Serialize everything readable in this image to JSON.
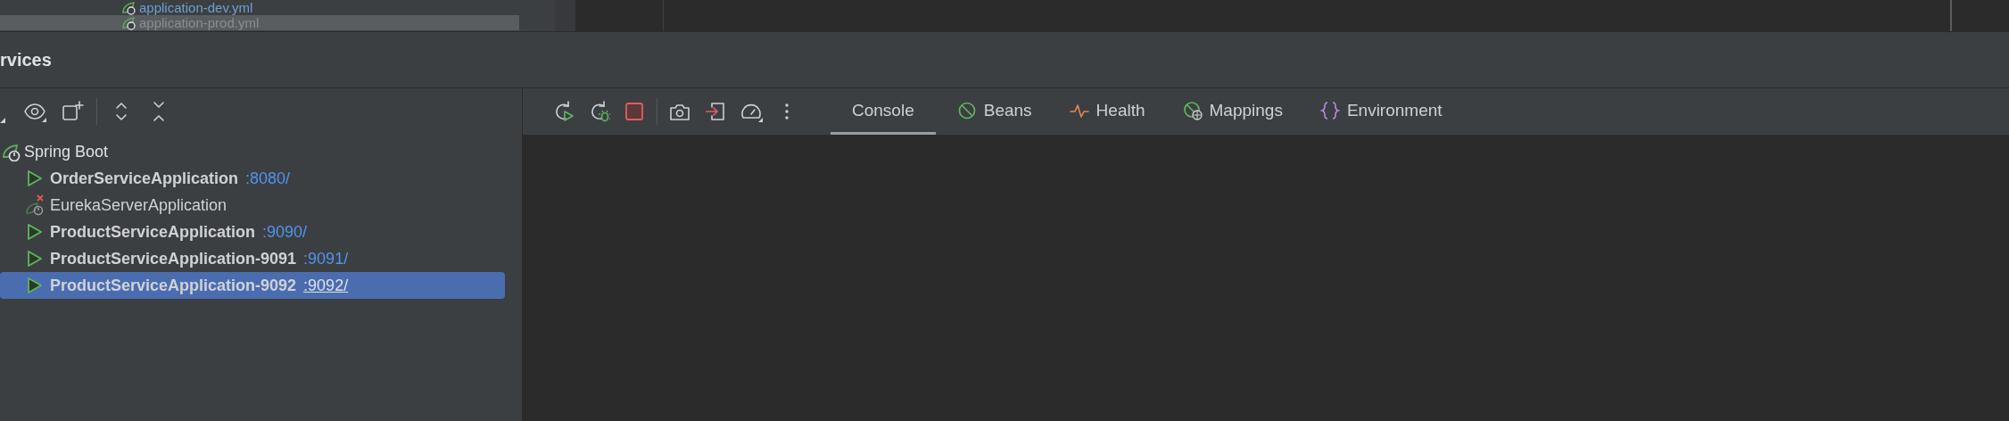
{
  "project_tree": {
    "items": [
      {
        "label": "application-dev.yml",
        "selected": false
      },
      {
        "label": "application-prod.yml",
        "selected": true
      }
    ]
  },
  "services": {
    "title": "rvices",
    "tree": {
      "label": "Spring Boot",
      "children": [
        {
          "name": "OrderServiceApplication",
          "port": ":8080/",
          "kind": "running",
          "selected": false
        },
        {
          "name": "EurekaServerApplication",
          "kind": "failed",
          "selected": false
        },
        {
          "name": "ProductServiceApplication",
          "port": ":9090/",
          "kind": "running",
          "selected": false
        },
        {
          "name": "ProductServiceApplication-9091",
          "port": ":9091/",
          "kind": "running",
          "selected": false
        },
        {
          "name": "ProductServiceApplication-9092",
          "port": ":9092/",
          "kind": "running",
          "selected": true
        }
      ]
    },
    "tabs": [
      {
        "label": "Console",
        "kind": "console",
        "selected": true
      },
      {
        "label": "Beans",
        "kind": "beans",
        "selected": false
      },
      {
        "label": "Health",
        "kind": "health",
        "selected": false
      },
      {
        "label": "Mappings",
        "kind": "mappings",
        "selected": false
      },
      {
        "label": "Environment",
        "kind": "environment",
        "selected": false
      }
    ]
  }
}
